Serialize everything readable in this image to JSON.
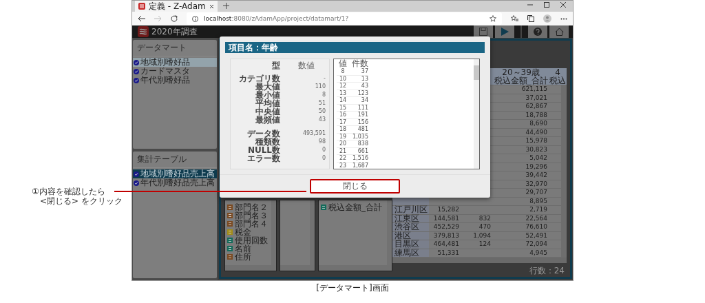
{
  "browser": {
    "tab_title": "定義 - Z-Adam",
    "url_host": "localhost",
    "url_path": ":8080/zAdamApp/project/datamart/1?"
  },
  "app": {
    "title": "2020年調査"
  },
  "sidebar": {
    "panels": [
      {
        "title": "データマート",
        "items": [
          {
            "label": "地域別嗜好品",
            "selected": true
          },
          {
            "label": "カードマスタ",
            "selected": false
          },
          {
            "label": "年代別嗜好品",
            "selected": false
          }
        ]
      },
      {
        "title": "集計テーブル",
        "items": [
          {
            "label": "地域別嗜好品売上高",
            "selected": true
          },
          {
            "label": "年代別嗜好品売上高",
            "selected": false
          }
        ]
      }
    ]
  },
  "field_panels": {
    "first": [
      {
        "label": "部門名２",
        "kind": "text"
      },
      {
        "label": "部門名３",
        "kind": "text"
      },
      {
        "label": "部門名４",
        "kind": "text"
      },
      {
        "label": "税金",
        "kind": "money"
      },
      {
        "label": "使用回数",
        "kind": "number"
      },
      {
        "label": "名前",
        "kind": "number"
      },
      {
        "label": "住所",
        "kind": "text"
      }
    ],
    "third": [
      {
        "label": "税込金額_合計",
        "kind": "number"
      }
    ]
  },
  "data_table": {
    "headers": [
      {
        "line1": "20～39歳",
        "line2": "税込金額_合計"
      },
      {
        "line1": "4",
        "line2": "税込"
      }
    ],
    "rows": [
      {
        "column_4": "621,115"
      },
      {
        "column_4": "37,021"
      },
      {
        "column_4": "62,867"
      },
      {
        "column_4": "18,788"
      },
      {
        "column_4": "8,690"
      },
      {
        "column_4": "44,490"
      },
      {
        "column_4": "15,978"
      },
      {
        "column_4": "30,823"
      },
      {
        "column_4": "5,042"
      },
      {
        "column_4": "19,296"
      },
      {
        "column_4": "39,442"
      },
      {
        "column_4": "32,970"
      },
      {
        "column_4": "29,707"
      },
      {
        "column_4": "8,895"
      },
      {
        "district": "江戸川区",
        "column_2": "15,282",
        "column_4": "2,719"
      },
      {
        "district": "江東区",
        "column_2": "144,581",
        "column_3": "832",
        "column_4": "22,564"
      },
      {
        "district": "渋谷区",
        "column_2": "452,529",
        "column_3": "470",
        "column_4": "76,610"
      },
      {
        "district": "港区",
        "column_2": "379,813",
        "column_3": "1,094",
        "column_4": "52,491"
      },
      {
        "district": "目黒区",
        "column_2": "464,481",
        "column_3": "124",
        "column_4": "72,094"
      },
      {
        "district": "練馬区",
        "column_2": "51,331",
        "column_4": "4,945"
      }
    ],
    "row_count": "行数：24"
  },
  "dialog": {
    "title": "項目名：年齢",
    "type_label": "型",
    "type_value": "数値",
    "stat_groups": [
      [
        {
          "label": "カテゴリ数",
          "value": "-"
        },
        {
          "label": "最大値",
          "value": "110"
        },
        {
          "label": "最小値",
          "value": "8"
        },
        {
          "label": "平均値",
          "value": "51"
        },
        {
          "label": "中央値",
          "value": "50"
        },
        {
          "label": "最頻値",
          "value": "43"
        }
      ],
      [
        {
          "label": "データ数",
          "value": "493,591"
        },
        {
          "label": "種類数",
          "value": "98"
        },
        {
          "label": "NULL数",
          "value": "0"
        },
        {
          "label": "エラー数",
          "value": "0"
        }
      ]
    ],
    "frequency_columns": [
      "値",
      "件数"
    ],
    "frequency_rows": [
      [
        "8",
        "37"
      ],
      [
        "10",
        "13"
      ],
      [
        "12",
        "43"
      ],
      [
        "13",
        "123"
      ],
      [
        "14",
        "34"
      ],
      [
        "15",
        "111"
      ],
      [
        "16",
        "191"
      ],
      [
        "17",
        "156"
      ],
      [
        "18",
        "481"
      ],
      [
        "19",
        "1,035"
      ],
      [
        "20",
        "838"
      ],
      [
        "21",
        "661"
      ],
      [
        "22",
        "1,516"
      ],
      [
        "23",
        "1,687"
      ]
    ],
    "close_button": "閉じる"
  },
  "annotation": "①内容を確認したら\n　<閉じる> をクリック",
  "caption": "[データマート]画面"
}
